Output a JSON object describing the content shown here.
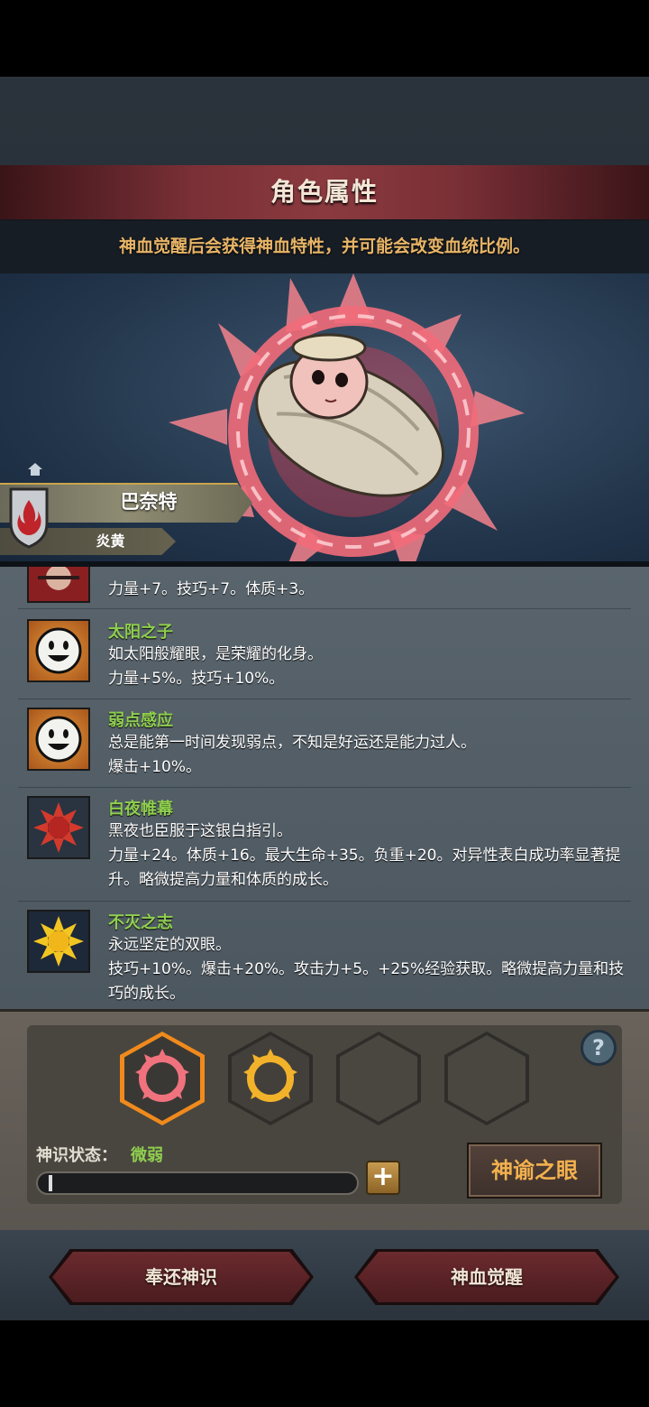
{
  "header": {
    "title": "角色属性",
    "subtitle": "神血觉醒后会获得神血特性，并可能会改变血统比例。"
  },
  "character": {
    "name": "巴奈特",
    "race": "炎黄"
  },
  "traits": [
    {
      "name": "",
      "desc": "力量+7。技巧+7。体质+3。",
      "icon": "red-crest-icon"
    },
    {
      "name": "太阳之子",
      "desc": "如太阳般耀眼，是荣耀的化身。\n力量+5%。技巧+10%。",
      "icon": "smiley-sun-icon"
    },
    {
      "name": "弱点感应",
      "desc": "总是能第一时间发现弱点，不知是好运还是能力过人。\n爆击+10%。",
      "icon": "smiley-sun-icon"
    },
    {
      "name": "白夜帷幕",
      "desc": "黑夜也臣服于这银白指引。\n力量+24。体质+16。最大生命+35。负重+20。对异性表白成功率显著提升。略微提高力量和体质的成长。",
      "icon": "red-sun-icon"
    },
    {
      "name": "不灭之志",
      "desc": "永远坚定的双眼。\n技巧+10%。爆击+20%。攻击力+5。+25%经验获取。略微提高力量和技巧的成长。",
      "icon": "gold-sun-icon"
    }
  ],
  "divinity": {
    "status_label": "神识状态：",
    "status_value": "微弱",
    "progress": 0.01,
    "oracle_button": "神谕之眼",
    "help": "?"
  },
  "actions": {
    "return_button": "奉还神识",
    "awaken_button": "神血觉醒"
  },
  "colors": {
    "accent_green": "#8fcf4f",
    "accent_gold": "#f3b14e",
    "banner_red": "#7a3036"
  }
}
